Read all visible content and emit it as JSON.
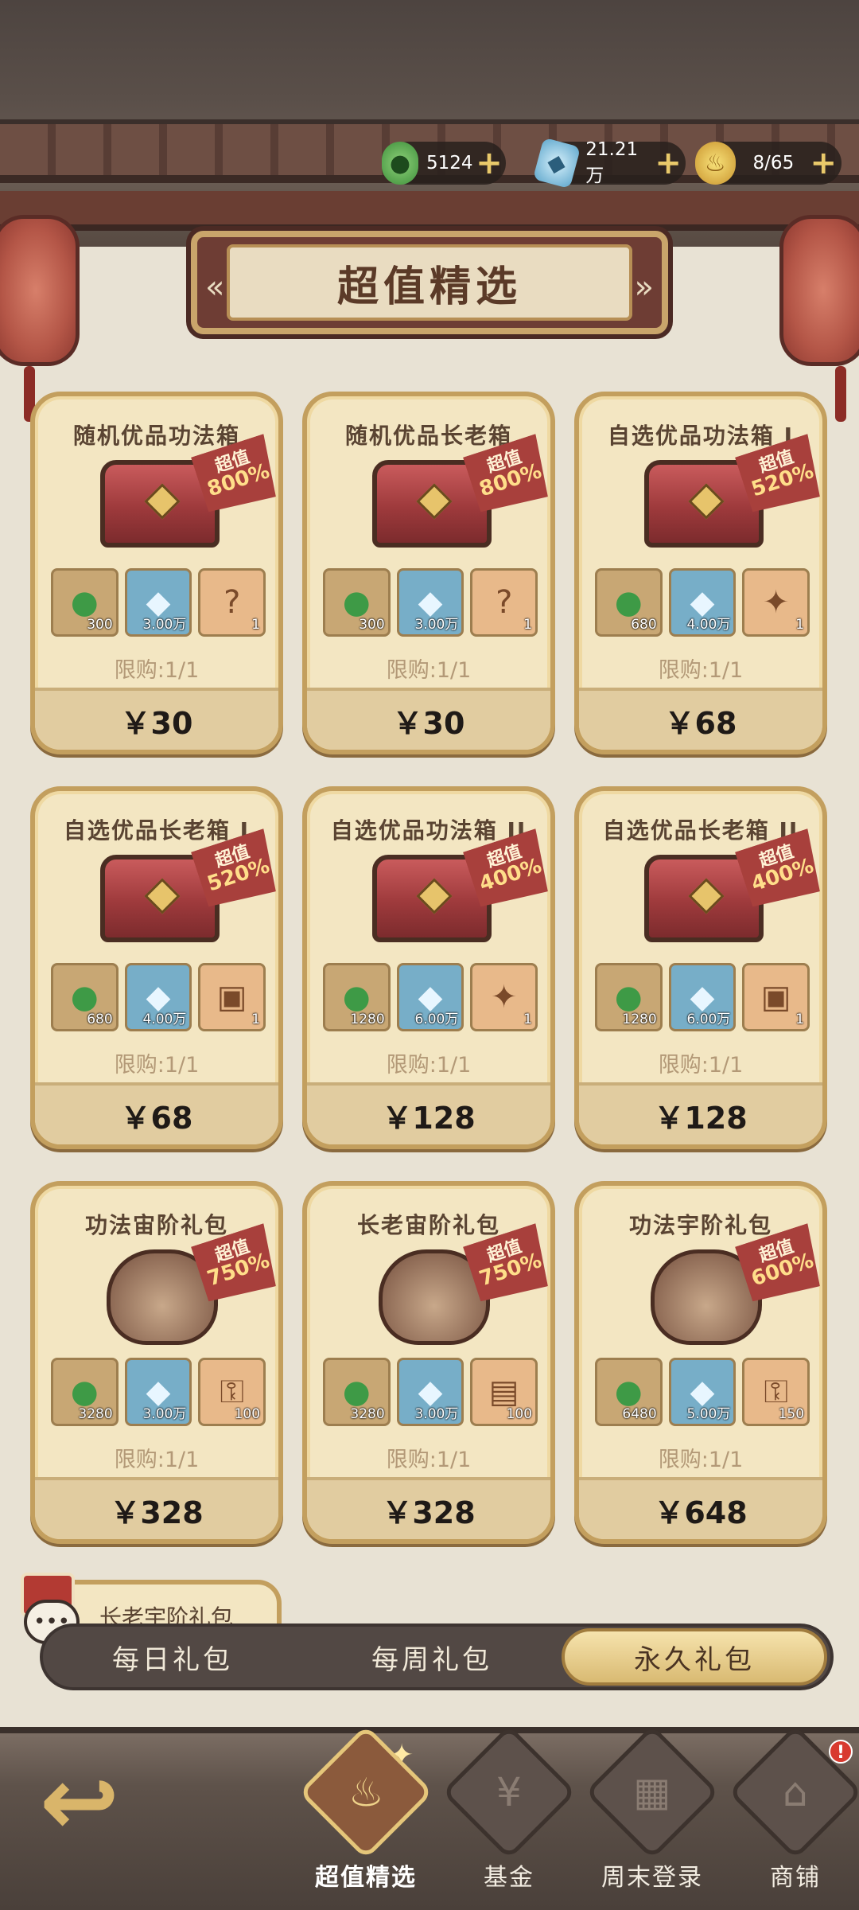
{
  "header": {
    "title": "超值精选",
    "currencies": [
      {
        "icon": "jade-icon",
        "value": "5124"
      },
      {
        "icon": "crystal-icon",
        "value": "21.21万"
      },
      {
        "icon": "gold-icon",
        "value": "8/65"
      }
    ]
  },
  "cards": [
    {
      "name": "随机优品功法箱",
      "badge_label": "超值",
      "badge_pct": "800%",
      "item1_qty": "300",
      "item2_qty": "3.00万",
      "item3_qty": "1",
      "limit": "限购:1/1",
      "price": "￥30"
    },
    {
      "name": "随机优品长老箱",
      "badge_label": "超值",
      "badge_pct": "800%",
      "item1_qty": "300",
      "item2_qty": "3.00万",
      "item3_qty": "1",
      "limit": "限购:1/1",
      "price": "￥30"
    },
    {
      "name": "自选优品功法箱 I",
      "badge_label": "超值",
      "badge_pct": "520%",
      "item1_qty": "680",
      "item2_qty": "4.00万",
      "item3_qty": "1",
      "limit": "限购:1/1",
      "price": "￥68"
    },
    {
      "name": "自选优品长老箱 I",
      "badge_label": "超值",
      "badge_pct": "520%",
      "item1_qty": "680",
      "item2_qty": "4.00万",
      "item3_qty": "1",
      "limit": "限购:1/1",
      "price": "￥68"
    },
    {
      "name": "自选优品功法箱 II",
      "badge_label": "超值",
      "badge_pct": "400%",
      "item1_qty": "1280",
      "item2_qty": "6.00万",
      "item3_qty": "1",
      "limit": "限购:1/1",
      "price": "￥128"
    },
    {
      "name": "自选优品长老箱 II",
      "badge_label": "超值",
      "badge_pct": "400%",
      "item1_qty": "1280",
      "item2_qty": "6.00万",
      "item3_qty": "1",
      "limit": "限购:1/1",
      "price": "￥128"
    },
    {
      "name": "功法宙阶礼包",
      "badge_label": "超值",
      "badge_pct": "750%",
      "item1_qty": "3280",
      "item2_qty": "3.00万",
      "item3_qty": "100",
      "limit": "限购:1/1",
      "price": "￥328"
    },
    {
      "name": "长老宙阶礼包",
      "badge_label": "超值",
      "badge_pct": "750%",
      "item1_qty": "3280",
      "item2_qty": "3.00万",
      "item3_qty": "100",
      "limit": "限购:1/1",
      "price": "￥328"
    },
    {
      "name": "功法宇阶礼包",
      "badge_label": "超值",
      "badge_pct": "600%",
      "item1_qty": "6480",
      "item2_qty": "5.00万",
      "item3_qty": "150",
      "limit": "限购:1/1",
      "price": "￥648"
    }
  ],
  "partial_card": {
    "name": "长老宇阶礼包"
  },
  "tabs": [
    {
      "label": "每日礼包"
    },
    {
      "label": "每周礼包"
    },
    {
      "label": "永久礼包"
    }
  ],
  "nav": [
    {
      "label": "超值精选"
    },
    {
      "label": "基金"
    },
    {
      "label": "周末登录"
    },
    {
      "label": "商铺",
      "badge": "!"
    }
  ],
  "colors": {
    "accent": "#c39f5e",
    "badge": "#a8403c",
    "active_tab": "#d9ba72"
  }
}
